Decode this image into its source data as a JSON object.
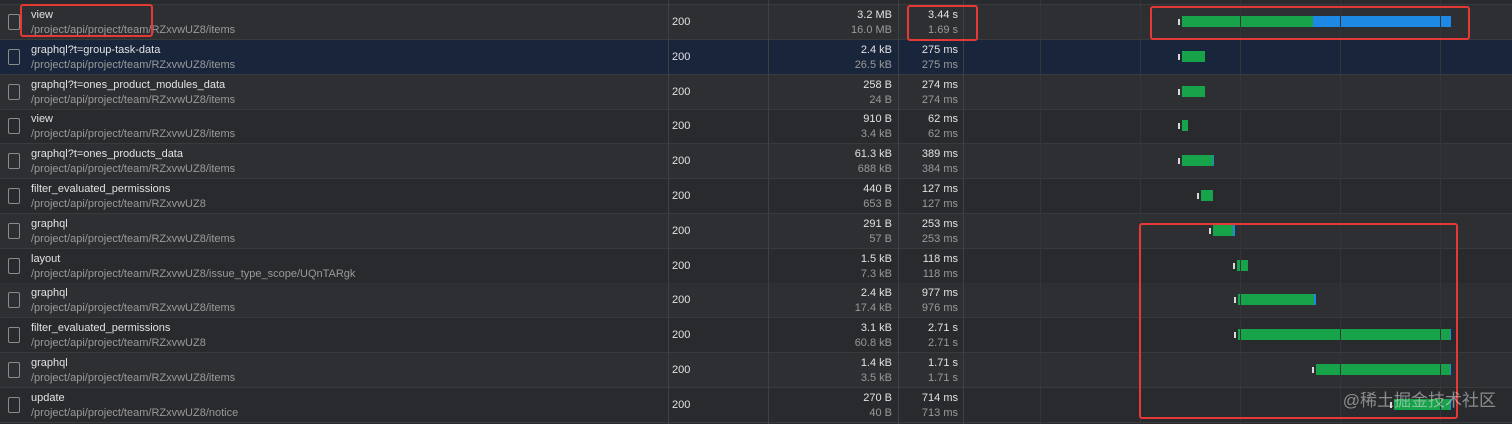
{
  "requests": [
    {
      "name": "view",
      "path": "/project/api/project/team/RZxvwUZ8/items",
      "status": "200",
      "size_transferred": "3.2 MB",
      "size_resource": "16.0 MB",
      "time_total": "3.44 s",
      "time_latency": "1.69 s",
      "start": 1182,
      "wait": 131,
      "download": 138
    },
    {
      "name": "graphql?t=group-task-data",
      "path": "/project/api/project/team/RZxvwUZ8/items",
      "status": "200",
      "size_transferred": "2.4 kB",
      "size_resource": "26.5 kB",
      "time_total": "275 ms",
      "time_latency": "275 ms",
      "start": 1182,
      "wait": 23,
      "download": 0
    },
    {
      "name": "graphql?t=ones_product_modules_data",
      "path": "/project/api/project/team/RZxvwUZ8/items",
      "status": "200",
      "size_transferred": "258 B",
      "size_resource": "24 B",
      "time_total": "274 ms",
      "time_latency": "274 ms",
      "start": 1182,
      "wait": 23,
      "download": 0
    },
    {
      "name": "view",
      "path": "/project/api/project/team/RZxvwUZ8/items",
      "status": "200",
      "size_transferred": "910 B",
      "size_resource": "3.4 kB",
      "time_total": "62 ms",
      "time_latency": "62 ms",
      "start": 1182,
      "wait": 6,
      "download": 0
    },
    {
      "name": "graphql?t=ones_products_data",
      "path": "/project/api/project/team/RZxvwUZ8/items",
      "status": "200",
      "size_transferred": "61.3 kB",
      "size_resource": "688 kB",
      "time_total": "389 ms",
      "time_latency": "384 ms",
      "start": 1182,
      "wait": 31,
      "download": 1
    },
    {
      "name": "filter_evaluated_permissions",
      "path": "/project/api/project/team/RZxvwUZ8",
      "status": "200",
      "size_transferred": "440 B",
      "size_resource": "653 B",
      "time_total": "127 ms",
      "time_latency": "127 ms",
      "start": 1201,
      "wait": 12,
      "download": 0
    },
    {
      "name": "graphql",
      "path": "/project/api/project/team/RZxvwUZ8/items",
      "status": "200",
      "size_transferred": "291 B",
      "size_resource": "57 B",
      "time_total": "253 ms",
      "time_latency": "253 ms",
      "start": 1213,
      "wait": 20,
      "download": 2
    },
    {
      "name": "layout",
      "path": "/project/api/project/team/RZxvwUZ8/issue_type_scope/UQnTARgk",
      "status": "200",
      "size_transferred": "1.5 kB",
      "size_resource": "7.3 kB",
      "time_total": "118 ms",
      "time_latency": "118 ms",
      "start": 1237,
      "wait": 11,
      "download": 0
    },
    {
      "name": "graphql",
      "path": "/project/api/project/team/RZxvwUZ8/items",
      "status": "200",
      "size_transferred": "2.4 kB",
      "size_resource": "17.4 kB",
      "time_total": "977 ms",
      "time_latency": "976 ms",
      "start": 1238,
      "wait": 76,
      "download": 2
    },
    {
      "name": "filter_evaluated_permissions",
      "path": "/project/api/project/team/RZxvwUZ8",
      "status": "200",
      "size_transferred": "3.1 kB",
      "size_resource": "60.8 kB",
      "time_total": "2.71 s",
      "time_latency": "2.71 s",
      "start": 1238,
      "wait": 212,
      "download": 1
    },
    {
      "name": "graphql",
      "path": "/project/api/project/team/RZxvwUZ8/items",
      "status": "200",
      "size_transferred": "1.4 kB",
      "size_resource": "3.5 kB",
      "time_total": "1.71 s",
      "time_latency": "1.71 s",
      "start": 1316,
      "wait": 134,
      "download": 1
    },
    {
      "name": "update",
      "path": "/project/api/project/team/RZxvwUZ8/notice",
      "status": "200",
      "size_transferred": "270 B",
      "size_resource": "40 B",
      "time_total": "714 ms",
      "time_latency": "713 ms",
      "start": 1394,
      "wait": 56,
      "download": 1
    }
  ],
  "selected_index": 1,
  "colors": {
    "waiting": "#16a34a",
    "download": "#1e88e5",
    "annotation": "#e53935",
    "selected_row": "#19253a"
  },
  "watermark": "@稀土掘金技术社区"
}
